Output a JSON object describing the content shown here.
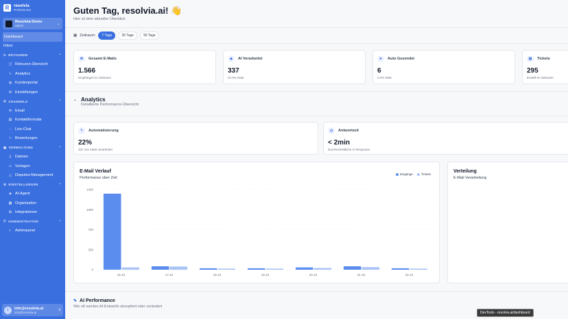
{
  "sidebar": {
    "brand_name": "resolvia",
    "brand_plan": "Professional",
    "org_name": "Resolvia Demo",
    "org_role": "admin",
    "items": {
      "dashboard": "Dashboard",
      "inbox": "Inbox"
    },
    "sections": [
      {
        "label": "RETOUREN",
        "items": [
          "Retouren-Übersicht",
          "Analytics",
          "Kundenportal",
          "Einstellungen"
        ]
      },
      {
        "label": "CHANNELS",
        "items": [
          "Email",
          "Kontaktformular",
          "Live-Chat",
          "Bewertungen"
        ]
      },
      {
        "label": "VERWALTUNG",
        "items": [
          "Dateien",
          "Vorlagen",
          "Disputes-Management"
        ]
      },
      {
        "label": "EINSTELLUNGEN",
        "items": [
          "AI-Agent",
          "Organisation",
          "Integrationen"
        ]
      },
      {
        "label": "ADMINISTRATION",
        "items": [
          "Adminpanel"
        ]
      }
    ],
    "user_name": "info@resolvia.ai",
    "user_email": "info@resolvia.ai"
  },
  "header": {
    "title": "Guten Tag, resolvia.ai! 👋",
    "subtitle": "Hier ist dein aktueller Überblick"
  },
  "range": {
    "label": "Zeitraum:",
    "options": [
      "7 Tage",
      "30 Tage",
      "90 Tage"
    ]
  },
  "kpis": [
    {
      "label": "Gesamt E-Mails",
      "value": "1.566",
      "sub": "Empfangen im Zeitraum"
    },
    {
      "label": "AI Verarbeitet",
      "value": "337",
      "sub": "22.0% Rate"
    },
    {
      "label": "Auto Gesendet",
      "value": "6",
      "sub": "2.0% Rate"
    },
    {
      "label": "Tickets",
      "value": "295",
      "sub": "Erstellt im Zeitraum"
    }
  ],
  "analytics": {
    "title": "Analytics",
    "subtitle": "Detaillierte Performance-Übersicht",
    "automation": {
      "label": "Automatisierung",
      "value": "22%",
      "sub": "337 von 1566 verarbeitet"
    },
    "response": {
      "label": "Antwortzeit",
      "value": "< 2min",
      "sub": "Durchschnittliche AI Response"
    }
  },
  "chart_data": {
    "type": "bar",
    "title": "E-Mail Verlauf",
    "subtitle": "Performance über Zeit",
    "categories": [
      "16.10.",
      "17.10.",
      "18.10.",
      "19.10.",
      "20.10.",
      "21.10.",
      "22.10."
    ],
    "series": [
      {
        "name": "Eingänge",
        "values": [
          1330,
          60,
          25,
          25,
          40,
          60,
          25
        ],
        "color": "#5b8def"
      },
      {
        "name": "Tickets",
        "values": [
          40,
          55,
          20,
          20,
          30,
          45,
          20
        ],
        "color": "#a9c3f5"
      }
    ],
    "yticks": [
      0,
      350,
      700,
      1050,
      1400
    ],
    "ylim": [
      0,
      1400
    ],
    "grid": true,
    "legend": "top-right"
  },
  "distribution": {
    "title": "Verteilung",
    "subtitle": "E-Mail Verarbeitung"
  },
  "ai_performance": {
    "title": "AI Performance",
    "subtitle": "Wie oft werden AI-Entwürfe akzeptiert oder verändert"
  },
  "devtools_label": "DevTools - resolvia.ai/dashboard"
}
